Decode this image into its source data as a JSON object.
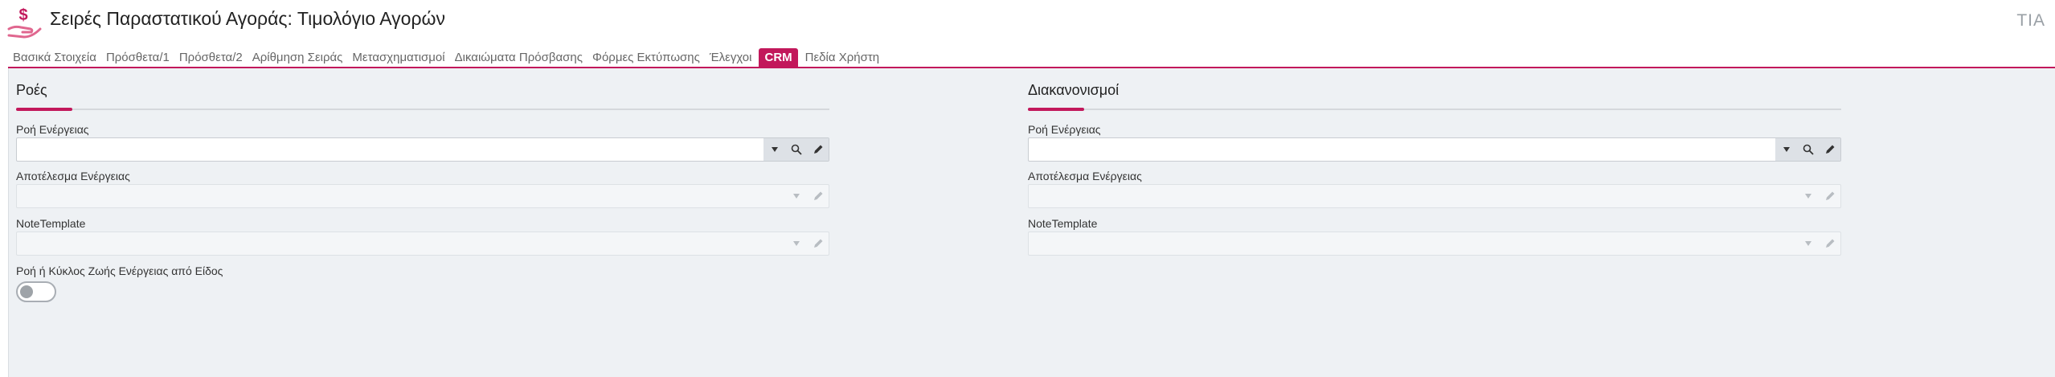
{
  "header": {
    "title": "Σειρές Παραστατικού Αγοράς: Τιμολόγιο Αγορών",
    "user_badge": "ΤΙΑ",
    "app_icon": "money-hand-icon"
  },
  "tabs": [
    {
      "label": "Βασικά Στοιχεία",
      "active": false
    },
    {
      "label": "Πρόσθετα/1",
      "active": false
    },
    {
      "label": "Πρόσθετα/2",
      "active": false
    },
    {
      "label": "Αρίθμηση Σειράς",
      "active": false
    },
    {
      "label": "Μετασχηματισμοί",
      "active": false
    },
    {
      "label": "Δικαιώματα Πρόσβασης",
      "active": false
    },
    {
      "label": "Φόρμες Εκτύπωσης",
      "active": false
    },
    {
      "label": "Έλεγχοι",
      "active": false
    },
    {
      "label": "CRM",
      "active": true
    },
    {
      "label": "Πεδία Χρήστη",
      "active": false
    }
  ],
  "left_section": {
    "title": "Ροές",
    "fields": [
      {
        "label": "Ροή Ενέργειας",
        "value": "",
        "enabled": true
      },
      {
        "label": "Αποτέλεσμα Ενέργειας",
        "value": "",
        "enabled": false
      },
      {
        "label": "NoteTemplate",
        "value": "",
        "enabled": false
      }
    ],
    "toggle": {
      "label": "Ροή ή Κύκλος Ζωής Ενέργειας από Είδος",
      "checked": false
    }
  },
  "right_section": {
    "title": "Διακανονισμοί",
    "fields": [
      {
        "label": "Ροή Ενέργειας",
        "value": "",
        "enabled": true
      },
      {
        "label": "Αποτέλεσμα Ενέργειας",
        "value": "",
        "enabled": false
      },
      {
        "label": "NoteTemplate",
        "value": "",
        "enabled": false
      }
    ]
  },
  "colors": {
    "accent": "#c2185b",
    "panel_bg": "#eef1f4",
    "field_border": "#c8ccd1",
    "button_bg": "#dde1e6"
  },
  "icons": {
    "dropdown": "caret-down-icon",
    "search": "search-icon",
    "edit": "pencil-icon"
  }
}
